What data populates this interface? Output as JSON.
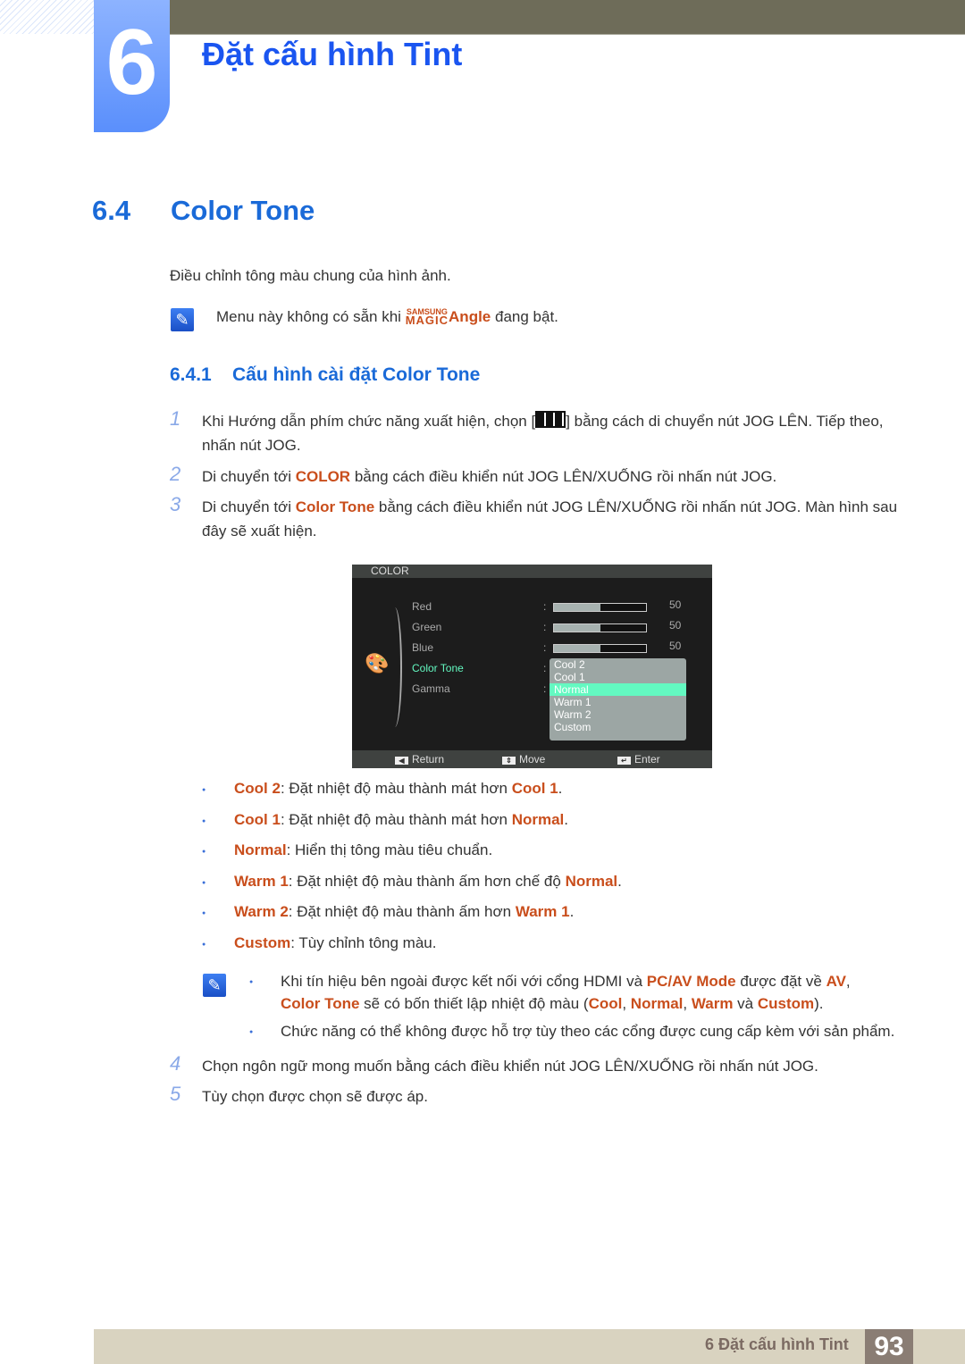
{
  "chapter": {
    "number": "6",
    "title": "Đặt cấu hình Tint"
  },
  "section": {
    "number": "6.4",
    "title": "Color Tone"
  },
  "intro": "Điều chỉnh tông màu chung của hình ảnh.",
  "note1": {
    "icon": "note-pencil-icon",
    "before": "Menu này không có sẵn khi ",
    "logo_top": "SAMSUNG",
    "logo_bottom": "MAGIC",
    "highlight": "Angle",
    "after": " đang bật."
  },
  "subsection": {
    "number": "6.4.1",
    "title": "Cấu hình cài đặt Color Tone"
  },
  "steps": [
    {
      "num": "1",
      "segments": [
        {
          "t": "Khi Hướng dẫn phím chức năng xuất hiện, chọn ["
        },
        {
          "icon": "menu-icon"
        },
        {
          "t": "] bằng cách di chuyển nút JOG LÊN. Tiếp theo, nhấn nút JOG."
        }
      ]
    },
    {
      "num": "2",
      "segments": [
        {
          "t": "Di chuyển tới "
        },
        {
          "t": "COLOR",
          "h": true
        },
        {
          "t": " bằng cách điều khiển nút JOG LÊN/XUỐNG rồi nhấn nút JOG."
        }
      ]
    },
    {
      "num": "3",
      "segments": [
        {
          "t": "Di chuyển tới "
        },
        {
          "t": "Color Tone",
          "h": true
        },
        {
          "t": " bằng cách điều khiển nút JOG LÊN/XUỐNG rồi nhấn nút JOG. Màn hình sau đây sẽ xuất hiện."
        }
      ]
    },
    {
      "num": "4",
      "segments": [
        {
          "t": "Chọn ngôn ngữ mong muốn bằng cách điều khiển nút JOG LÊN/XUỐNG rồi nhấn nút JOG."
        }
      ]
    },
    {
      "num": "5",
      "segments": [
        {
          "t": "Tùy chọn được chọn sẽ được áp."
        }
      ]
    }
  ],
  "osd": {
    "title": "COLOR",
    "icon": "palette-icon",
    "items": [
      {
        "label": "Red",
        "value": "50",
        "level_percent": 50
      },
      {
        "label": "Green",
        "value": "50",
        "level_percent": 50
      },
      {
        "label": "Blue",
        "value": "50",
        "level_percent": 50
      },
      {
        "label": "Color Tone",
        "active": true
      },
      {
        "label": "Gamma"
      }
    ],
    "options": [
      "Cool 2",
      "Cool 1",
      "Normal",
      "Warm 1",
      "Warm 2",
      "Custom"
    ],
    "selected": "Normal",
    "footer": [
      {
        "icon": "left-arrow-key-icon",
        "label": "Return"
      },
      {
        "icon": "up-down-key-icon",
        "label": "Move"
      },
      {
        "icon": "enter-key-icon",
        "label": "Enter"
      }
    ],
    "colors": {
      "active_text": "#63f9c1",
      "selected_bg": "#63f9c1",
      "dropdown_bg": "#9ca6a4"
    }
  },
  "bullets": [
    [
      {
        "t": "Cool 2",
        "h": true
      },
      {
        "t": ": Đặt nhiệt độ màu thành mát hơn "
      },
      {
        "t": "Cool 1",
        "h": true
      },
      {
        "t": "."
      }
    ],
    [
      {
        "t": "Cool 1",
        "h": true
      },
      {
        "t": ": Đặt nhiệt độ màu thành mát hơn "
      },
      {
        "t": "Normal",
        "h": true
      },
      {
        "t": "."
      }
    ],
    [
      {
        "t": "Normal",
        "h": true
      },
      {
        "t": ": Hiển thị tông màu tiêu chuẩn."
      }
    ],
    [
      {
        "t": "Warm 1",
        "h": true
      },
      {
        "t": ": Đặt nhiệt độ màu thành ấm hơn chế độ "
      },
      {
        "t": "Normal",
        "h": true
      },
      {
        "t": "."
      }
    ],
    [
      {
        "t": "Warm 2",
        "h": true
      },
      {
        "t": ": Đặt nhiệt độ màu thành ấm hơn "
      },
      {
        "t": "Warm 1",
        "h": true
      },
      {
        "t": "."
      }
    ],
    [
      {
        "t": "Custom",
        "h": true
      },
      {
        "t": ": Tùy chỉnh tông màu."
      }
    ]
  ],
  "note2": [
    [
      {
        "t": "Khi tín hiệu bên ngoài được kết nối với cổng HDMI và "
      },
      {
        "t": "PC/AV Mode",
        "h": true
      },
      {
        "t": " được đặt về "
      },
      {
        "t": "AV",
        "h": true
      },
      {
        "t": ","
      },
      {
        "br": true
      },
      {
        "t": "Color Tone",
        "h": true
      },
      {
        "t": " sẽ có bốn thiết lập nhiệt độ màu ("
      },
      {
        "t": "Cool",
        "h": true
      },
      {
        "t": ", "
      },
      {
        "t": "Normal",
        "h": true
      },
      {
        "t": ", "
      },
      {
        "t": "Warm",
        "h": true
      },
      {
        "t": " và "
      },
      {
        "t": "Custom",
        "h": true
      },
      {
        "t": ")."
      }
    ],
    [
      {
        "t": "Chức năng có thể không được hỗ trợ tùy theo các cổng được cung cấp kèm với sản phẩm."
      }
    ]
  ],
  "footer": {
    "text": "6 Đặt cấu hình Tint",
    "page": "93"
  },
  "colors": {
    "heading_blue": "#1a55f0",
    "highlight_orange": "#c94e1c",
    "footer_bg": "#d9d3c0",
    "page_box": "#8a7d74"
  }
}
